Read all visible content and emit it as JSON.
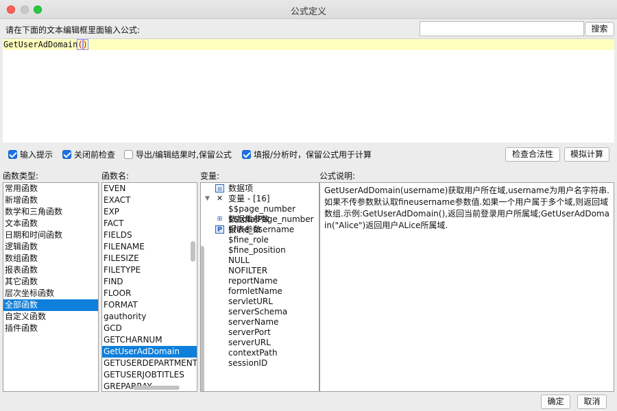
{
  "window": {
    "title": "公式定义"
  },
  "search": {
    "prompt": "请在下面的文本编辑框里面输入公式:",
    "value": "",
    "button": "搜索"
  },
  "editor": {
    "formula_name": "GetUserAdDomain",
    "open_paren": "(",
    "close_paren": ")"
  },
  "options": [
    {
      "label": "输入提示",
      "checked": true
    },
    {
      "label": "关闭前检查",
      "checked": true
    },
    {
      "label": "导出/编辑结果时,保留公式",
      "checked": false
    },
    {
      "label": "填报/分析时，保留公式用于计算",
      "checked": true
    }
  ],
  "buttons": {
    "check_validity": "检查合法性",
    "simulate": "模拟计算",
    "ok": "确定",
    "cancel": "取消"
  },
  "labels": {
    "func_type": "函数类型:",
    "func_name": "函数名:",
    "variables": "变量:",
    "description": "公式说明:"
  },
  "func_types": [
    "常用函数",
    "新增函数",
    "数学和三角函数",
    "文本函数",
    "日期和时间函数",
    "逻辑函数",
    "数组函数",
    "报表函数",
    "其它函数",
    "层次坐标函数",
    "全部函数",
    "自定义函数",
    "插件函数"
  ],
  "func_type_selected": 10,
  "func_names": [
    "EVEN",
    "EXACT",
    "EXP",
    "FACT",
    "FIELDS",
    "FILENAME",
    "FILESIZE",
    "FILETYPE",
    "FIND",
    "FLOOR",
    "FORMAT",
    "gauthority",
    "GCD",
    "GETCHARNUM",
    "GetUserAdDomain",
    "GETUSERDEPARTMENTS",
    "GETUSERJOBTITLES",
    "GREPARRAY"
  ],
  "func_name_selected": 14,
  "variables": {
    "data_items": "数据项",
    "var_node": "变量 - [16]",
    "items": [
      "$$page_number",
      "$$totalPage_number",
      "$fine_username",
      "$fine_role",
      "$fine_position",
      "NULL",
      "NOFILTER",
      "reportName",
      "formletName",
      "servletURL",
      "serverSchema",
      "serverName",
      "serverPort",
      "serverURL",
      "contextPath",
      "sessionID"
    ],
    "dataset_params": "数据集参数",
    "report_params": "报表参数"
  },
  "icons": {
    "data_items": "table-icon",
    "var_node": "variable-icon",
    "dataset_params": "dataset-param-icon",
    "report_params": "report-param-icon"
  },
  "description": {
    "lines": [
      "GetUserAdDomain(username)获取用户所在域,username为用户名字符串.如果不传参数默认取fineusername参数值.如果一个用户属于多个域,则返回域数组.示例:GetUserAdDomain(),返回当前登录用户所属域;GetUserAdDomain(\"Alice\")返回用户ALice所属域."
    ]
  },
  "colors": {
    "accent": "#0f7fdc",
    "editor_highlight": "#ffffbe",
    "check_blue": "#1a73e8"
  }
}
